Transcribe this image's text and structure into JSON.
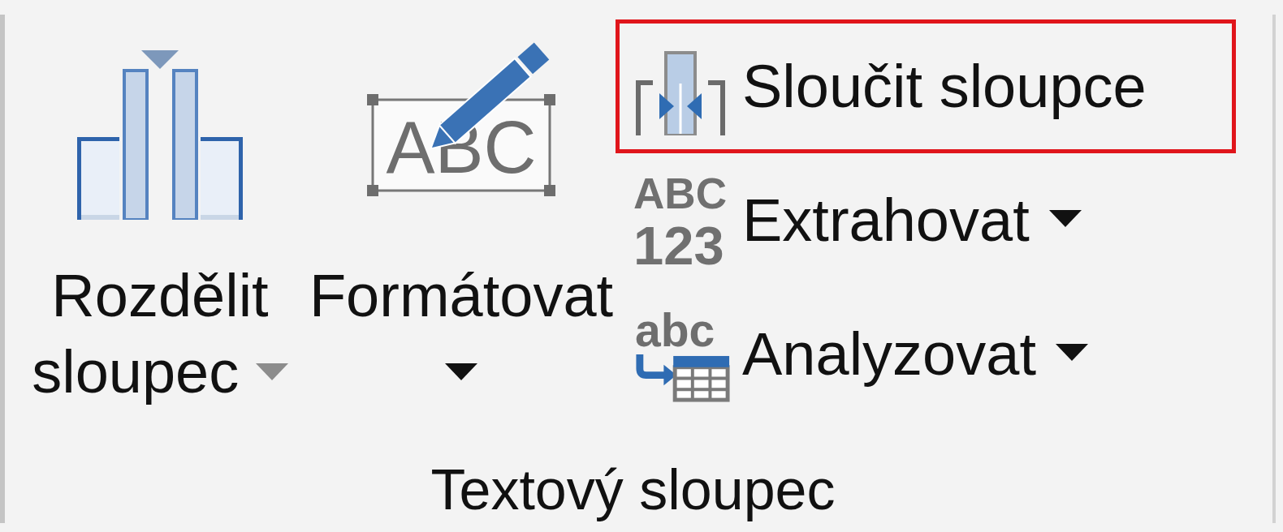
{
  "ribbon_group": {
    "large_buttons": [
      {
        "kind": "split",
        "label": "Rozdělit sloupec",
        "dropdown": true,
        "dropdown_dimmed": true
      },
      {
        "kind": "format",
        "label": "Formátovat",
        "dropdown": true,
        "dropdown_dimmed": false,
        "icon_text": [
          "ABC"
        ]
      }
    ],
    "small_buttons": [
      {
        "kind": "merge",
        "label": "Sloučit sloupce",
        "dropdown": false,
        "highlighted": true
      },
      {
        "kind": "extract",
        "label": "Extrahovat",
        "dropdown": true,
        "highlighted": false,
        "icon_text": [
          "ABC",
          "123"
        ]
      },
      {
        "kind": "parse",
        "label": "Analyzovat",
        "dropdown": true,
        "highlighted": false,
        "icon_text": [
          "abc"
        ]
      }
    ],
    "title": "Textový sloupec"
  }
}
